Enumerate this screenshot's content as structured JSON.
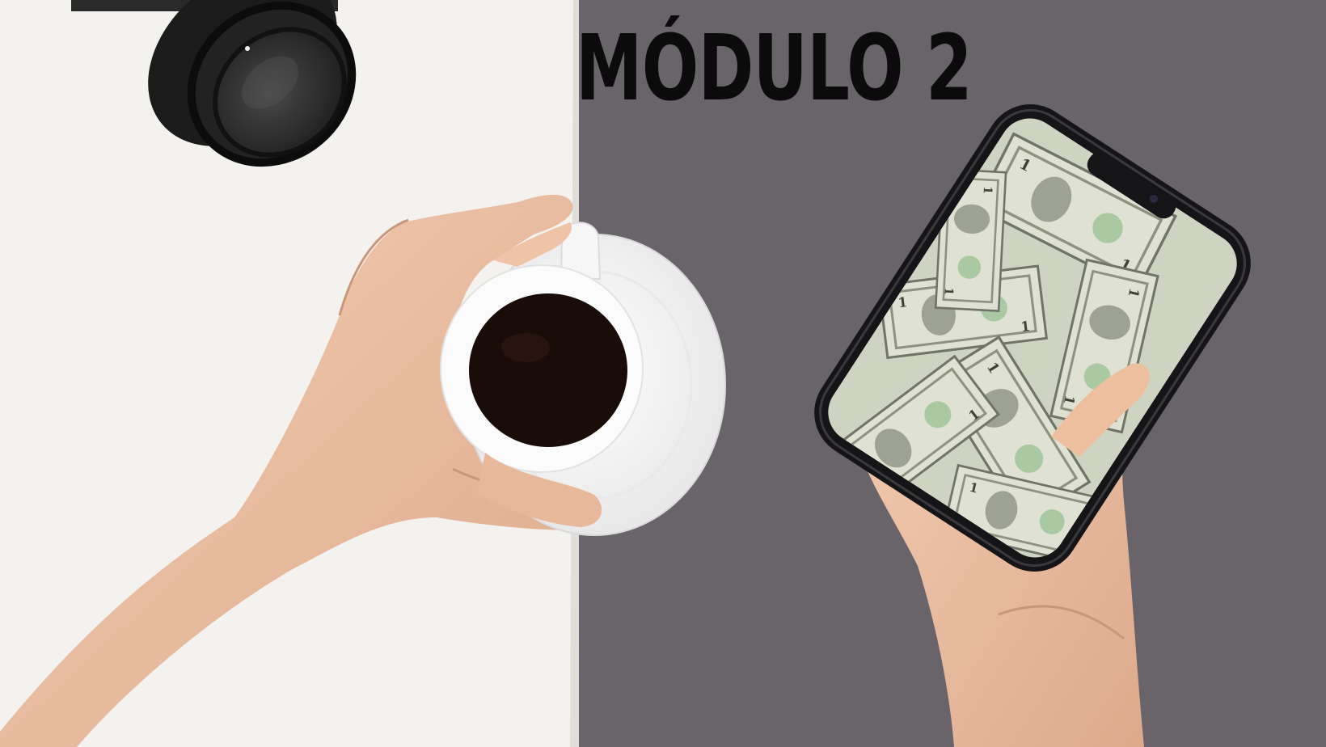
{
  "header": {
    "title": "MÓDULO 2"
  },
  "colors": {
    "background_left": "#f4f2ef",
    "background_right": "#69646a",
    "title": "#0b0b0b",
    "skin": "#ecc1a4",
    "coffee": "#1a0c08",
    "phone_body": "#151517",
    "banknote": "#d8dccb"
  },
  "icons": {
    "camera_lens": "camera-lens-icon",
    "coffee_cup": "coffee-cup-icon",
    "smartphone": "smartphone-icon",
    "banknote": "banknote-icon"
  }
}
